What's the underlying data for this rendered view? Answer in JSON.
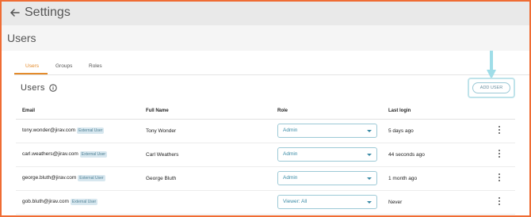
{
  "header": {
    "title": "Settings"
  },
  "page": {
    "heading": "Users"
  },
  "tabs": [
    {
      "label": "Users",
      "active": true
    },
    {
      "label": "Groups",
      "active": false
    },
    {
      "label": "Roles",
      "active": false
    }
  ],
  "section": {
    "title": "Users",
    "add_button": "ADD USER"
  },
  "table": {
    "headers": [
      "Email",
      "Full Name",
      "Role",
      "Last login"
    ],
    "rows": [
      {
        "email": "tony.wonder@jirav.com",
        "badge": "External User",
        "name": "Tony Wonder",
        "role": "Admin",
        "last_login": "5 days ago"
      },
      {
        "email": "carl.weathers@jirav.com",
        "badge": "External User",
        "name": "Carl Weathers",
        "role": "Admin",
        "last_login": "44 seconds ago"
      },
      {
        "email": "george.bluth@jirav.com",
        "badge": "External User",
        "name": "George Bluth",
        "role": "Admin",
        "last_login": "1 month ago"
      },
      {
        "email": "gob.bluth@jirav.com",
        "badge": "External User",
        "name": "",
        "role": "Viewer: All",
        "last_login": "Never"
      }
    ]
  },
  "colors": {
    "accent": "#e48b2b",
    "frame": "#ef6c34",
    "link": "#3a8aa5",
    "highlight": "#bfe3ea"
  },
  "icons": {
    "back": "arrow-left-icon",
    "info": "info-icon",
    "menu": "more-vertical-icon",
    "pointer": "arrow-down-icon"
  }
}
